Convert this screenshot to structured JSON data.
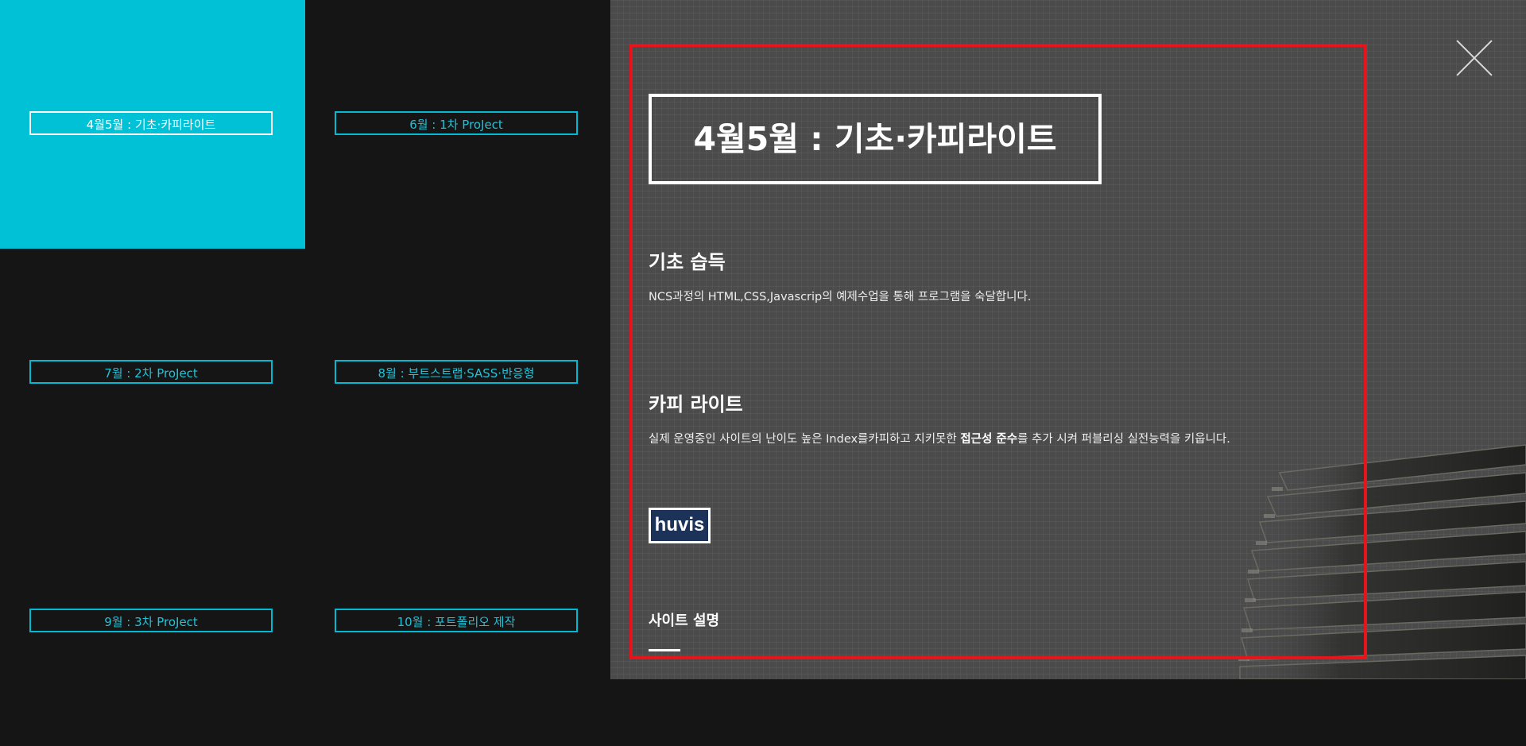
{
  "nav": {
    "items": [
      {
        "label": "4월5월 : 기초·카피라이트",
        "active": true
      },
      {
        "label": "6월 : 1차 ProJect"
      },
      {
        "label": "7월 : 2차 ProJect"
      },
      {
        "label": "8월 : 부트스트랩·SASS·반응형"
      },
      {
        "label": "9월 : 3차 ProJect"
      },
      {
        "label": "10월 : 포트폴리오 제작"
      }
    ]
  },
  "detail": {
    "title": "4월5월 : 기초·카피라이트",
    "section1": {
      "heading": "기초 습득",
      "text": "NCS과정의 HTML,CSS,Javascrip의 예제수업을 통해 프로그램을 숙달합니다."
    },
    "section2": {
      "heading": "카피 라이트",
      "text_before": "실제 운영중인 사이트의 난이도 높은 Index를카피하고 지키못한 ",
      "text_bold": "접근성 준수",
      "text_after": "를 추가 시켜 퍼블리싱 실전능력을 키웁니다."
    },
    "logo_text": "huvis",
    "site_desc_heading": "사이트 설명"
  },
  "colors": {
    "accent": "#00c1d6",
    "highlight_border": "#e8141c"
  },
  "icons": {
    "close": "close-x-icon"
  }
}
